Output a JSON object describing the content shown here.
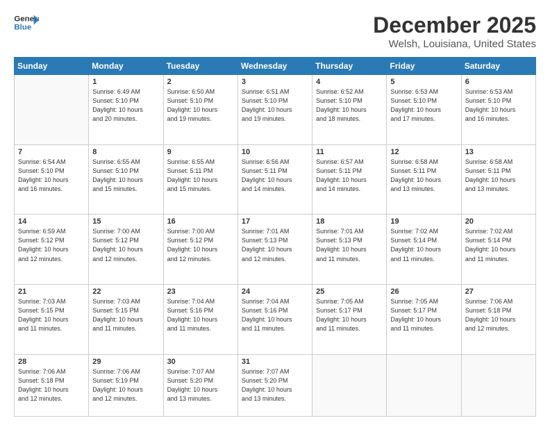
{
  "header": {
    "logo_line1": "General",
    "logo_line2": "Blue",
    "month": "December 2025",
    "location": "Welsh, Louisiana, United States"
  },
  "days_of_week": [
    "Sunday",
    "Monday",
    "Tuesday",
    "Wednesday",
    "Thursday",
    "Friday",
    "Saturday"
  ],
  "weeks": [
    [
      {
        "day": "",
        "info": ""
      },
      {
        "day": "1",
        "info": "Sunrise: 6:49 AM\nSunset: 5:10 PM\nDaylight: 10 hours\nand 20 minutes."
      },
      {
        "day": "2",
        "info": "Sunrise: 6:50 AM\nSunset: 5:10 PM\nDaylight: 10 hours\nand 19 minutes."
      },
      {
        "day": "3",
        "info": "Sunrise: 6:51 AM\nSunset: 5:10 PM\nDaylight: 10 hours\nand 19 minutes."
      },
      {
        "day": "4",
        "info": "Sunrise: 6:52 AM\nSunset: 5:10 PM\nDaylight: 10 hours\nand 18 minutes."
      },
      {
        "day": "5",
        "info": "Sunrise: 6:53 AM\nSunset: 5:10 PM\nDaylight: 10 hours\nand 17 minutes."
      },
      {
        "day": "6",
        "info": "Sunrise: 6:53 AM\nSunset: 5:10 PM\nDaylight: 10 hours\nand 16 minutes."
      }
    ],
    [
      {
        "day": "7",
        "info": "Sunrise: 6:54 AM\nSunset: 5:10 PM\nDaylight: 10 hours\nand 16 minutes."
      },
      {
        "day": "8",
        "info": "Sunrise: 6:55 AM\nSunset: 5:10 PM\nDaylight: 10 hours\nand 15 minutes."
      },
      {
        "day": "9",
        "info": "Sunrise: 6:55 AM\nSunset: 5:11 PM\nDaylight: 10 hours\nand 15 minutes."
      },
      {
        "day": "10",
        "info": "Sunrise: 6:56 AM\nSunset: 5:11 PM\nDaylight: 10 hours\nand 14 minutes."
      },
      {
        "day": "11",
        "info": "Sunrise: 6:57 AM\nSunset: 5:11 PM\nDaylight: 10 hours\nand 14 minutes."
      },
      {
        "day": "12",
        "info": "Sunrise: 6:58 AM\nSunset: 5:11 PM\nDaylight: 10 hours\nand 13 minutes."
      },
      {
        "day": "13",
        "info": "Sunrise: 6:58 AM\nSunset: 5:11 PM\nDaylight: 10 hours\nand 13 minutes."
      }
    ],
    [
      {
        "day": "14",
        "info": "Sunrise: 6:59 AM\nSunset: 5:12 PM\nDaylight: 10 hours\nand 12 minutes."
      },
      {
        "day": "15",
        "info": "Sunrise: 7:00 AM\nSunset: 5:12 PM\nDaylight: 10 hours\nand 12 minutes."
      },
      {
        "day": "16",
        "info": "Sunrise: 7:00 AM\nSunset: 5:12 PM\nDaylight: 10 hours\nand 12 minutes."
      },
      {
        "day": "17",
        "info": "Sunrise: 7:01 AM\nSunset: 5:13 PM\nDaylight: 10 hours\nand 12 minutes."
      },
      {
        "day": "18",
        "info": "Sunrise: 7:01 AM\nSunset: 5:13 PM\nDaylight: 10 hours\nand 11 minutes."
      },
      {
        "day": "19",
        "info": "Sunrise: 7:02 AM\nSunset: 5:14 PM\nDaylight: 10 hours\nand 11 minutes."
      },
      {
        "day": "20",
        "info": "Sunrise: 7:02 AM\nSunset: 5:14 PM\nDaylight: 10 hours\nand 11 minutes."
      }
    ],
    [
      {
        "day": "21",
        "info": "Sunrise: 7:03 AM\nSunset: 5:15 PM\nDaylight: 10 hours\nand 11 minutes."
      },
      {
        "day": "22",
        "info": "Sunrise: 7:03 AM\nSunset: 5:15 PM\nDaylight: 10 hours\nand 11 minutes."
      },
      {
        "day": "23",
        "info": "Sunrise: 7:04 AM\nSunset: 5:16 PM\nDaylight: 10 hours\nand 11 minutes."
      },
      {
        "day": "24",
        "info": "Sunrise: 7:04 AM\nSunset: 5:16 PM\nDaylight: 10 hours\nand 11 minutes."
      },
      {
        "day": "25",
        "info": "Sunrise: 7:05 AM\nSunset: 5:17 PM\nDaylight: 10 hours\nand 11 minutes."
      },
      {
        "day": "26",
        "info": "Sunrise: 7:05 AM\nSunset: 5:17 PM\nDaylight: 10 hours\nand 11 minutes."
      },
      {
        "day": "27",
        "info": "Sunrise: 7:06 AM\nSunset: 5:18 PM\nDaylight: 10 hours\nand 12 minutes."
      }
    ],
    [
      {
        "day": "28",
        "info": "Sunrise: 7:06 AM\nSunset: 5:18 PM\nDaylight: 10 hours\nand 12 minutes."
      },
      {
        "day": "29",
        "info": "Sunrise: 7:06 AM\nSunset: 5:19 PM\nDaylight: 10 hours\nand 12 minutes."
      },
      {
        "day": "30",
        "info": "Sunrise: 7:07 AM\nSunset: 5:20 PM\nDaylight: 10 hours\nand 13 minutes."
      },
      {
        "day": "31",
        "info": "Sunrise: 7:07 AM\nSunset: 5:20 PM\nDaylight: 10 hours\nand 13 minutes."
      },
      {
        "day": "",
        "info": ""
      },
      {
        "day": "",
        "info": ""
      },
      {
        "day": "",
        "info": ""
      }
    ]
  ]
}
